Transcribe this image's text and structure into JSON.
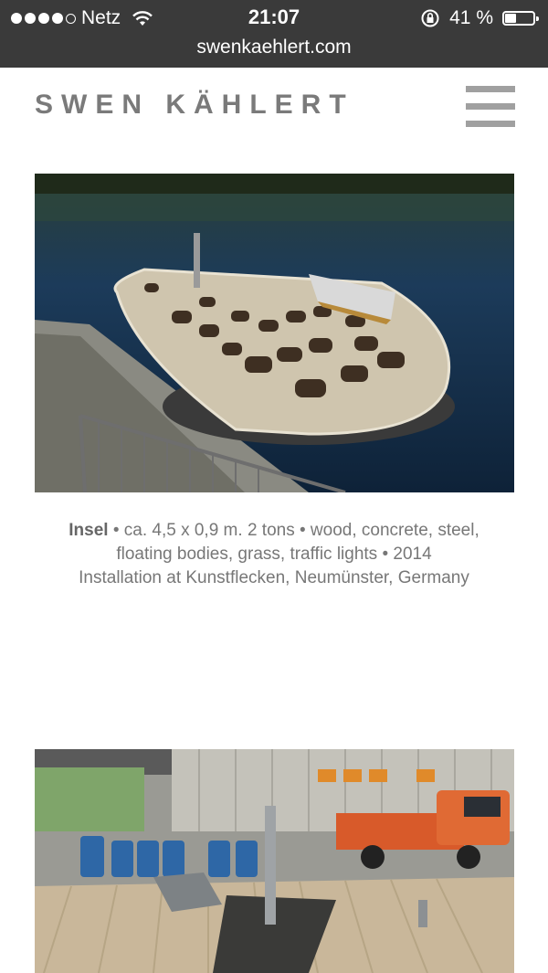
{
  "status_bar": {
    "carrier": "Netz",
    "signal_bars": 4,
    "signal_max": 5,
    "time": "21:07",
    "battery": "41 %",
    "battery_level": 0.41,
    "url": "swenkaehlert.com"
  },
  "header": {
    "logo": "SWEN KÄHLERT",
    "menu_icon": "hamburger-menu-icon"
  },
  "work": {
    "title": "Insel",
    "details_line1": "• ca. 4,5 x 0,9 m. 2 tons • wood, concrete, steel,",
    "details_line2": "floating bodies, grass, traffic lights • 2014",
    "details_line3": "Installation at Kunstflecken, Neumünster, Germany"
  },
  "colors": {
    "status_bar_bg": "#3a3a3a",
    "logo_text": "#7a7a7a",
    "caption_text": "#777777",
    "menu_icon": "#a0a0a0"
  }
}
